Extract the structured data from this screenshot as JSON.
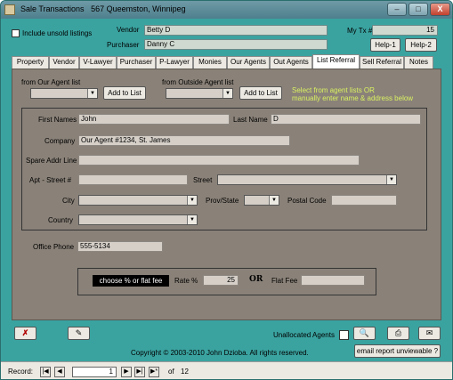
{
  "window": {
    "title": "Sale Transactions",
    "subtitle": "567 Queemston, Winnipeg",
    "minimize_glyph": "–",
    "maximize_glyph": "□",
    "close_glyph": "X"
  },
  "header": {
    "include_unsold_label": "Include unsold listings",
    "vendor_label": "Vendor",
    "vendor_value": "Betty D",
    "purchaser_label": "Purchaser",
    "purchaser_value": "Danny C",
    "my_tx_label": "My Tx #",
    "my_tx_value": "15",
    "help1_label": "Help-1",
    "help2_label": "Help-2"
  },
  "tabs": [
    "Property",
    "Vendor",
    "V-Lawyer",
    "Purchaser",
    "P-Lawyer",
    "Monies",
    "Our Agents",
    "Out Agents",
    "List Referral",
    "Sell Referral",
    "Notes"
  ],
  "active_tab": "List Referral",
  "referral": {
    "our_agent_label": "from Our Agent list",
    "outside_agent_label": "from Outside Agent list",
    "add_to_list_label": "Add to List",
    "instruction_line1": "Select from agent lists       OR",
    "instruction_line2": "manually enter name & address below",
    "first_names_label": "First Names",
    "first_names_value": "John",
    "last_name_label": "Last Name",
    "last_name_value": "D",
    "company_label": "Company",
    "company_value": "Our Agent #1234, St. James",
    "spare_addr_label": "Spare Addr Line",
    "spare_addr_value": "",
    "apt_label": "Apt - Street #",
    "apt_value": "",
    "street_label": "Street",
    "street_value": "",
    "city_label": "City",
    "city_value": "",
    "prov_label": "Prov/State",
    "prov_value": "",
    "postal_label": "Postal Code",
    "postal_value": "",
    "country_label": "Country",
    "country_value": "",
    "office_phone_label": "Office Phone",
    "office_phone_value": "555-5134",
    "choose_label": "choose % or flat fee",
    "rate_label": "Rate %",
    "rate_value": "25",
    "or_label": "OR",
    "flat_fee_label": "Flat Fee",
    "flat_fee_value": ""
  },
  "footer": {
    "unallocated_label": "Unallocated Agents",
    "copyright": "Copyright © 2003-2010 John Dzioba. All rights reserved.",
    "email_label": "email report unviewable ?"
  },
  "status": {
    "record_label": "Record:",
    "record_value": "1",
    "of_label": "of",
    "total": "12",
    "first_glyph": "|◀",
    "prev_glyph": "◀",
    "next_glyph": "▶",
    "last_glyph": "▶|",
    "new_glyph": "▶*"
  },
  "colors": {
    "window_bg": "#3aa3a0",
    "panel_bg": "#8a8279",
    "instruction_text": "#d8f060"
  }
}
